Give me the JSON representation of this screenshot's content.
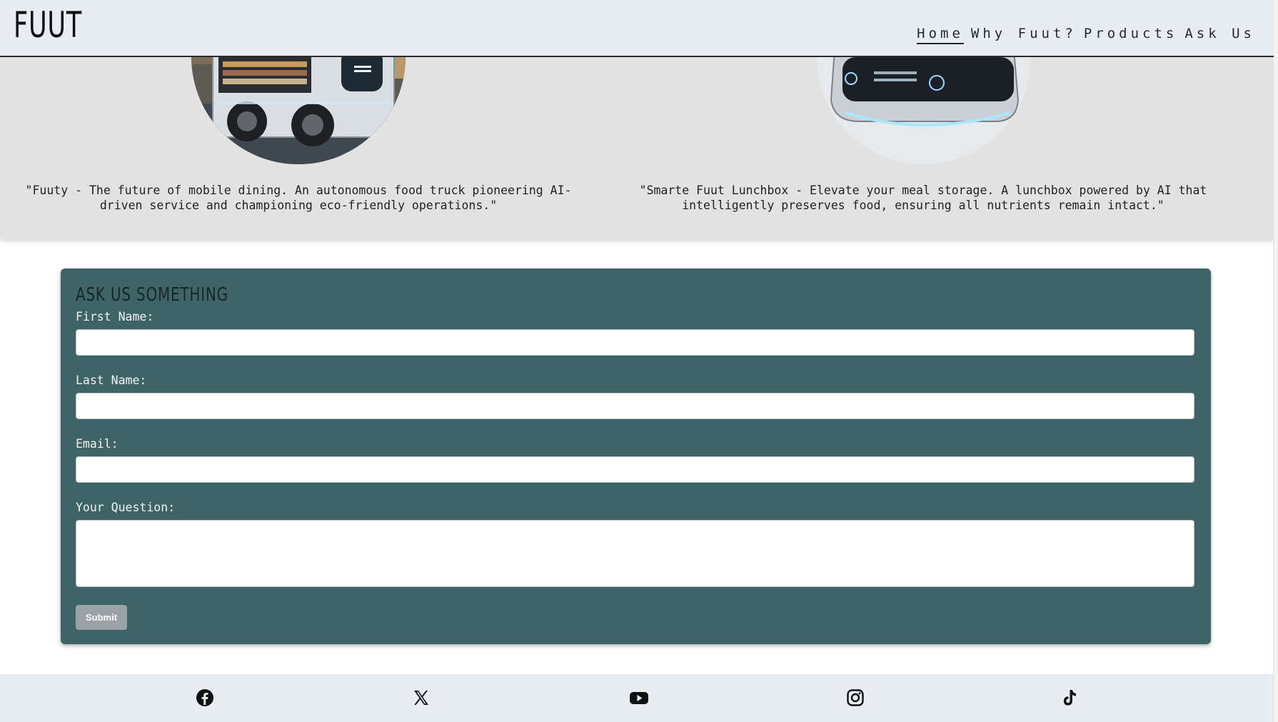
{
  "brand": {
    "logo": "FUUT"
  },
  "nav": [
    {
      "label": "Home",
      "active": true
    },
    {
      "label": "Why Fuut?",
      "active": false
    },
    {
      "label": "Products",
      "active": false
    },
    {
      "label": "Ask Us",
      "active": false
    }
  ],
  "products": [
    {
      "image": "autonomous-food-truck-image",
      "caption": "\"Fuuty - The future of mobile dining. An autonomous food truck pioneering AI-driven service and championing eco-friendly operations.\""
    },
    {
      "image": "smart-lunchbox-image",
      "caption": "\"Smarte Fuut Lunchbox - Elevate your meal storage. A lunchbox powered by AI that intelligently preserves food, ensuring all nutrients remain intact.\""
    }
  ],
  "form": {
    "title": "ASK US SOMETHING",
    "first_name_label": "First Name:",
    "first_name_value": "",
    "last_name_label": "Last Name:",
    "last_name_value": "",
    "email_label": "Email:",
    "email_value": "",
    "question_label": "Your Question:",
    "question_value": "",
    "submit_label": "Submit"
  },
  "footer": {
    "social": [
      "facebook-icon",
      "x-icon",
      "youtube-icon",
      "instagram-icon",
      "tiktok-icon"
    ]
  },
  "colors": {
    "header_bg": "#e8edf4",
    "band_bg": "#e2e2e2",
    "form_bg": "#3e6467",
    "submit_bg": "#9aa2a7"
  }
}
